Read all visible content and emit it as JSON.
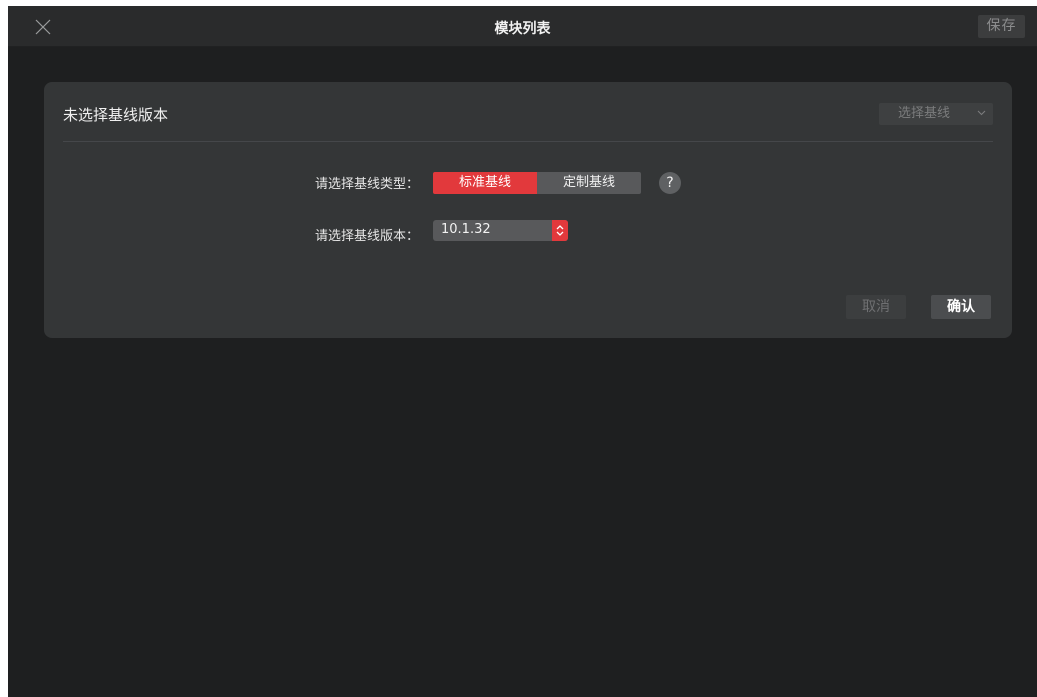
{
  "window": {
    "title": "模块列表",
    "save_label": "保存"
  },
  "panel": {
    "title": "未选择基线版本",
    "select_baseline_label": "选择基线",
    "type_row": {
      "label": "请选择基线类型：",
      "options": [
        "标准基线",
        "定制基线"
      ],
      "selected": "标准基线",
      "help_label": "?"
    },
    "version_row": {
      "label": "请选择基线版本：",
      "selected_version": "10.1.32"
    },
    "cancel_label": "取消",
    "confirm_label": "确认"
  },
  "icons": {
    "close": "close-icon",
    "chevron": "chevron-down-icon",
    "stepper": "updown-chevron-icon"
  },
  "colors": {
    "accent_red": "#e2393c",
    "background": "#1e1f20",
    "panel": "#343637"
  }
}
